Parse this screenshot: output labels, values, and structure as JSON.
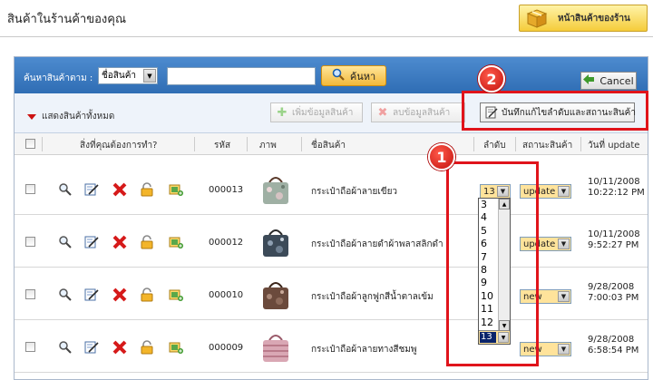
{
  "page": {
    "title": "สินค้าในร้านค้าของคุณ",
    "store_button": "หน้าสินค้าของร้าน"
  },
  "search": {
    "label": "ค้นหาสินค้าตาม :",
    "field_selected": "ชื่อสินค้า",
    "input_value": "",
    "button": "ค้นหา",
    "cancel": "Cancel"
  },
  "toolbar": {
    "show_all": "แสดงสินค้าทั้งหมด",
    "add": "เพิ่มข้อมูลสินค้า",
    "delete": "ลบข้อมูลสินค้า",
    "save": "บันทึกแก้ไขลำดับและสถานะสินค้า"
  },
  "table": {
    "headers": {
      "actions": "สิ่งที่คุณต้องการทำ?",
      "code": "รหัส",
      "image": "ภาพ",
      "name": "ชื่อสินค้า",
      "order": "ลำดับ",
      "status": "สถานะสินค้า",
      "date": "วันที่ update"
    },
    "rows": [
      {
        "code": "000013",
        "name": "กระเป๋าถือผ้าลายเขียว",
        "order": "13",
        "status": "update",
        "date": "10/11/2008",
        "time": "10:22:12 PM"
      },
      {
        "code": "000012",
        "name": "กระเป๋าถือผ้าลายดำผ้าพลาสลิกดำ",
        "order": "",
        "status": "update",
        "date": "10/11/2008",
        "time": "9:52:27 PM"
      },
      {
        "code": "000010",
        "name": "กระเป๋าถือผ้าลูกฟูกสีน้ำตาลเข้ม",
        "order": "",
        "status": "new",
        "date": "9/28/2008",
        "time": "7:00:03 PM"
      },
      {
        "code": "000009",
        "name": "กระเป๋าถือผ้าลายทางสีชมพู",
        "order": "",
        "status": "new",
        "date": "9/28/2008",
        "time": "6:58:54 PM"
      }
    ]
  },
  "order_dropdown": {
    "options": [
      "3",
      "4",
      "5",
      "6",
      "7",
      "8",
      "9",
      "10",
      "11",
      "12",
      "13"
    ],
    "selected": "13"
  },
  "annotations": {
    "callout_1": "1",
    "callout_2": "2"
  },
  "colors": {
    "header_blue": "#3b7bc4",
    "annotation_red": "#e0141b",
    "select_highlight": "#ffe39b"
  }
}
